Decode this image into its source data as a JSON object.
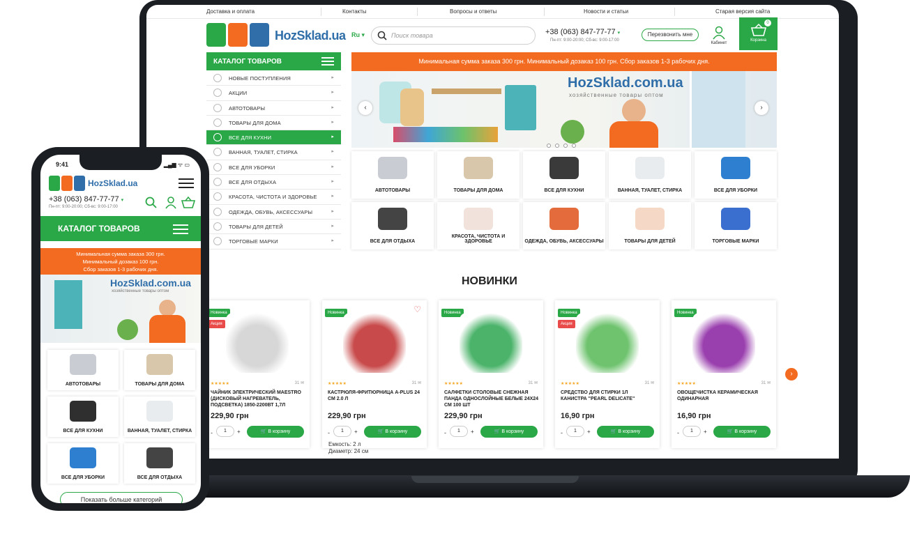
{
  "topnav": [
    "Доставка и оплата",
    "Контакты",
    "Вопросы и ответы",
    "Новости и статьи",
    "Старая версия сайта"
  ],
  "brand": {
    "name": "HozSklad.ua",
    "colors": {
      "green": "#2aa847",
      "orange": "#f26b21",
      "blue": "#2f6ea8"
    }
  },
  "header": {
    "lang": "Ru",
    "search_placeholder": "Поиск товара",
    "phone": "+38 (063) 847-77-77",
    "hours": "Пн-пт: 9:00-20:00; Сб-вс: 9:00-17:00",
    "callback_label": "Перезвонить мне",
    "cabinet_label": "Кабинет",
    "cart_label": "Корзина",
    "cart_count": "0"
  },
  "catalog": {
    "title": "КАТАЛОГ ТОВАРОВ",
    "items": [
      "НОВЫЕ ПОСТУПЛЕНИЯ",
      "АКЦИИ",
      "АВТОТОВАРЫ",
      "ТОВАРЫ ДЛЯ ДОМА",
      "ВСЕ ДЛЯ КУХНИ",
      "ВАННАЯ, ТУАЛЕТ, СТИРКА",
      "ВСЕ ДЛЯ УБОРКИ",
      "ВСЕ ДЛЯ ОТДЫХА",
      "КРАСОТА, ЧИСТОТА И ЗДОРОВЬЕ",
      "ОДЕЖДА, ОБУВЬ, АКСЕССУАРЫ",
      "ТОВАРЫ ДЛЯ ДЕТЕЙ",
      "ТОРГОВЫЕ МАРКИ"
    ],
    "active_index": 4
  },
  "promo": "Минимальная сумма заказа 300 грн. Минимальный дозаказ 100 грн. Сбор заказов 1-3 рабочих дня.",
  "banner": {
    "logo": "HozSklad.com.ua",
    "subtitle": "хозяйственные товары оптом"
  },
  "categories": [
    {
      "label": "АВТОТОВАРЫ",
      "color": "#c9ccd2"
    },
    {
      "label": "ТОВАРЫ ДЛЯ ДОМА",
      "color": "#d8c7aa"
    },
    {
      "label": "ВСЕ ДЛЯ КУХНИ",
      "color": "#3a3a3a"
    },
    {
      "label": "ВАННАЯ, ТУАЛЕТ, СТИРКА",
      "color": "#e9ecef"
    },
    {
      "label": "ВСЕ ДЛЯ УБОРКИ",
      "color": "#2f7fd1"
    },
    {
      "label": "ВСЕ ДЛЯ ОТДЫХА",
      "color": "#444444"
    },
    {
      "label": "КРАСОТА, ЧИСТОТА И ЗДОРОВЬЕ",
      "color": "#f1e3db"
    },
    {
      "label": "ОДЕЖДА, ОБУВЬ, АКСЕССУАРЫ",
      "color": "#e46b3c"
    },
    {
      "label": "ТОВАРЫ ДЛЯ ДЕТЕЙ",
      "color": "#f6d8c6"
    },
    {
      "label": "ТОРГОВЫЕ МАРКИ",
      "color": "#3b6fcf"
    }
  ],
  "new_section_title": "НОВИНКИ",
  "badges": {
    "new": "Новинка",
    "sale": "Акция"
  },
  "stars": "★★★★★",
  "add_to_cart": "В корзину",
  "products": [
    {
      "name": "ЧАЙНИК ЭЛЕКТРИЧЕСКИЙ MAESTRO (ДИСКОВЫЙ НАГРЕВАТЕЛЬ, ПОДСВЕТКА) 1850-2200ВТ 1,7Л",
      "price": "229,90 грн",
      "reviews": "31",
      "qty": "1",
      "badges": [
        "new",
        "sale"
      ],
      "color": "#d7d7d7"
    },
    {
      "name": "КАСТРЮЛЯ-ФРИТЮРНИЦА A-PLUS 24 СМ 2.0 Л",
      "price": "229,90 грн",
      "reviews": "31",
      "qty": "1",
      "badges": [
        "new"
      ],
      "color": "#c84a4a"
    },
    {
      "name": "САЛФЕТКИ СТОЛОВЫЕ СНЕЖНАЯ ПАНДА ОДНОСЛОЙНЫЕ БЕЛЫЕ 24Х24 СМ 100 ШТ",
      "price": "229,90 грн",
      "reviews": "31",
      "qty": "1",
      "badges": [
        "new"
      ],
      "color": "#4bb36a"
    },
    {
      "name": "СРЕДСТВО ДЛЯ СТИРКИ 1Л КАНИСТРА \"PEARL DELICATE\"",
      "price": "16,90 грн",
      "reviews": "31",
      "qty": "1",
      "badges": [
        "new",
        "sale"
      ],
      "color": "#6fc36f"
    },
    {
      "name": "ОВОЩЕЧИСТКА КЕРАМИЧЕСКАЯ ОДИНАРНАЯ",
      "price": "16,90 грн",
      "reviews": "31",
      "qty": "1",
      "badges": [
        "new"
      ],
      "color": "#9a3fae"
    }
  ],
  "product_extra": [
    "Емкость: 2 л",
    "Диаметр: 24 см"
  ],
  "phone_ui": {
    "time": "9:41",
    "status": "▂▄▆ ᯤ ▭",
    "logo": "HozSklad.ua",
    "phone": "+38 (063) 847-77-77",
    "hours": "Пн-пт: 9:00-20:00; Сб-вс: 9:00-17:00",
    "catalog_title": "КАТАЛОГ ТОВАРОВ",
    "promo_lines": [
      "Минимальная сумма заказа 300 грн.",
      "Минимальный дозаказ 100 грн.",
      "Сбор заказов 1-3 рабочих дня."
    ],
    "banner_logo": "HozSklad.com.ua",
    "banner_sub": "хозяйственные товары оптом",
    "tiles": [
      "АВТОТОВАРЫ",
      "ТОВАРЫ ДЛЯ ДОМА",
      "ВСЕ ДЛЯ КУХНИ",
      "ВАННАЯ, ТУАЛЕТ, СТИРКА",
      "ВСЕ ДЛЯ УБОРКИ",
      "ВСЕ ДЛЯ ОТДЫХА"
    ],
    "more_label": "Показать больше категорий"
  }
}
